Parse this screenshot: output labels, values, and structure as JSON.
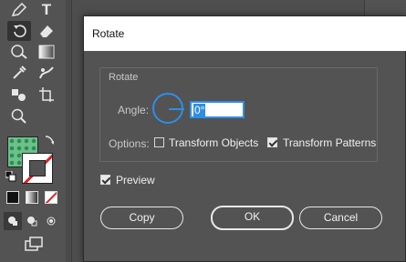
{
  "toolbar": {
    "tools": [
      "brush-icon",
      "type-icon",
      "rotate-icon",
      "eraser-icon",
      "warp-icon",
      "gradient-icon",
      "eyedropper-icon",
      "blend-icon",
      "symbol-icon",
      "artboard-icon",
      "zoom-icon",
      "swap-icon",
      "default-colors-icon",
      "screen-mode-icon"
    ],
    "type_tool_label": "T",
    "fill_color": "#6cc08a",
    "stroke_color": "#ffffff"
  },
  "dialog": {
    "title": "Rotate",
    "group_title": "Rotate",
    "angle_label": "Angle:",
    "angle_value": "0°",
    "options_label": "Options:",
    "transform_objects": {
      "label": "Transform Objects",
      "checked": false
    },
    "transform_patterns": {
      "label": "Transform Patterns",
      "checked": true
    },
    "preview": {
      "label": "Preview",
      "checked": true
    },
    "buttons": {
      "copy": "Copy",
      "ok": "OK",
      "cancel": "Cancel"
    },
    "accent_color": "#2e8ee6"
  }
}
